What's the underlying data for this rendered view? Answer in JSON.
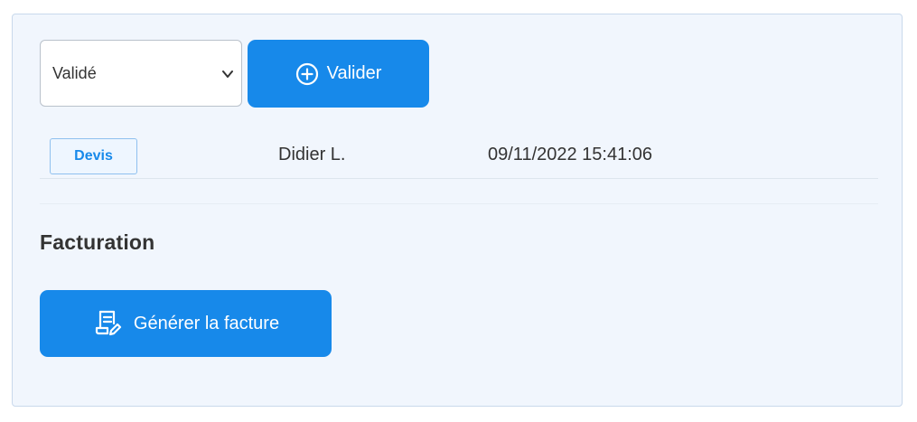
{
  "status_select": {
    "selected": "Validé",
    "icon": "chevron-down-icon"
  },
  "validate_button": {
    "label": "Valider",
    "icon": "plus-circle-icon"
  },
  "history_row": {
    "type_badge": "Devis",
    "author": "Didier L.",
    "timestamp": "09/11/2022 15:41:06"
  },
  "billing": {
    "title": "Facturation",
    "generate_button": {
      "label": "Générer la facture",
      "icon": "invoice-edit-icon"
    }
  },
  "colors": {
    "primary": "#1789ea",
    "panel_bg": "#f1f6fd",
    "text": "#333333"
  }
}
